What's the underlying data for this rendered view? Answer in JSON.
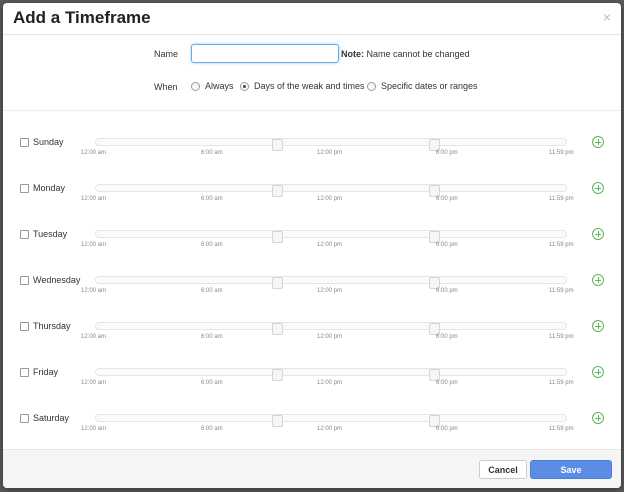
{
  "dialog": {
    "title": "Add a Timeframe",
    "close_glyph": "×"
  },
  "name_field": {
    "label": "Name",
    "value": "",
    "placeholder": "",
    "note_bold": "Note:",
    "note_text": " Name cannot be changed"
  },
  "when": {
    "label": "When",
    "options": [
      {
        "label": "Always",
        "selected": false
      },
      {
        "label": "Days of the weak and times",
        "selected": true
      },
      {
        "label": "Specific dates or ranges",
        "selected": false
      }
    ]
  },
  "days": [
    {
      "label": "Sunday",
      "checked": false
    },
    {
      "label": "Monday",
      "checked": false
    },
    {
      "label": "Tuesday",
      "checked": false
    },
    {
      "label": "Wednesday",
      "checked": false
    },
    {
      "label": "Thursday",
      "checked": false
    },
    {
      "label": "Friday",
      "checked": false
    },
    {
      "label": "Saturday",
      "checked": false
    }
  ],
  "ticks": [
    "12:00 am",
    "6:00 am",
    "12:00 pm",
    "6:00 pm",
    "11:59 pm"
  ],
  "icons": {
    "add": "plus-circle-icon",
    "close": "close-icon"
  },
  "colors": {
    "accent": "#5b8de6",
    "add_green": "#5cb85c",
    "input_focus": "#66afe9"
  },
  "footer": {
    "cancel_label": "Cancel",
    "save_label": "Save"
  }
}
